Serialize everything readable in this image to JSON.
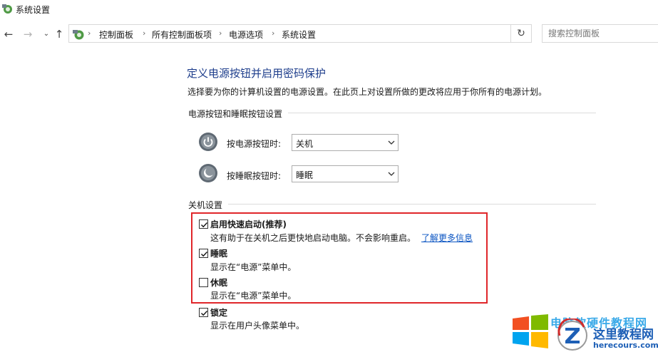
{
  "window": {
    "title": "系统设置"
  },
  "nav": {
    "breadcrumbs": [
      "控制面板",
      "所有控制面板项",
      "电源选项",
      "系统设置"
    ],
    "search_placeholder": "搜索控制面板"
  },
  "main": {
    "heading": "定义电源按钮并启用密码保护",
    "description": "选择要为你的计算机设置的电源设置。在此页上对设置所做的更改将应用于你所有的电源计划。",
    "power_section": {
      "title": "电源按钮和睡眠按钮设置",
      "rows": [
        {
          "label": "按电源按钮时:",
          "value": "关机"
        },
        {
          "label": "按睡眠按钮时:",
          "value": "睡眠"
        }
      ]
    },
    "shutdown_section": {
      "title": "关机设置",
      "options": [
        {
          "label": "启用快速启动(推荐)",
          "checked": true,
          "description": "这有助于在关机之后更快地启动电脑。不会影响重启。",
          "link": "了解更多信息"
        },
        {
          "label": "睡眠",
          "checked": true,
          "description": "显示在“电源”菜单中。"
        },
        {
          "label": "休眠",
          "checked": false,
          "description": "显示在“电源”菜单中。"
        },
        {
          "label": "锁定",
          "checked": true,
          "description": "显示在用户头像菜单中。"
        }
      ]
    }
  },
  "watermark": {
    "top_text": "电脑软硬件教程网",
    "site_name": "这里教程网",
    "url": "herecours.com"
  },
  "colors": {
    "heading": "#1e3e8c",
    "link": "#0a54c2",
    "highlight_box": "#e0262a"
  },
  "icons": [
    "control-panel-icon",
    "back-arrow-icon",
    "forward-arrow-icon",
    "recent-dropdown-icon",
    "up-arrow-icon",
    "refresh-icon",
    "power-button-icon",
    "sleep-button-icon",
    "checkbox-check-icon",
    "windows-logo-icon",
    "z-logo-icon"
  ]
}
